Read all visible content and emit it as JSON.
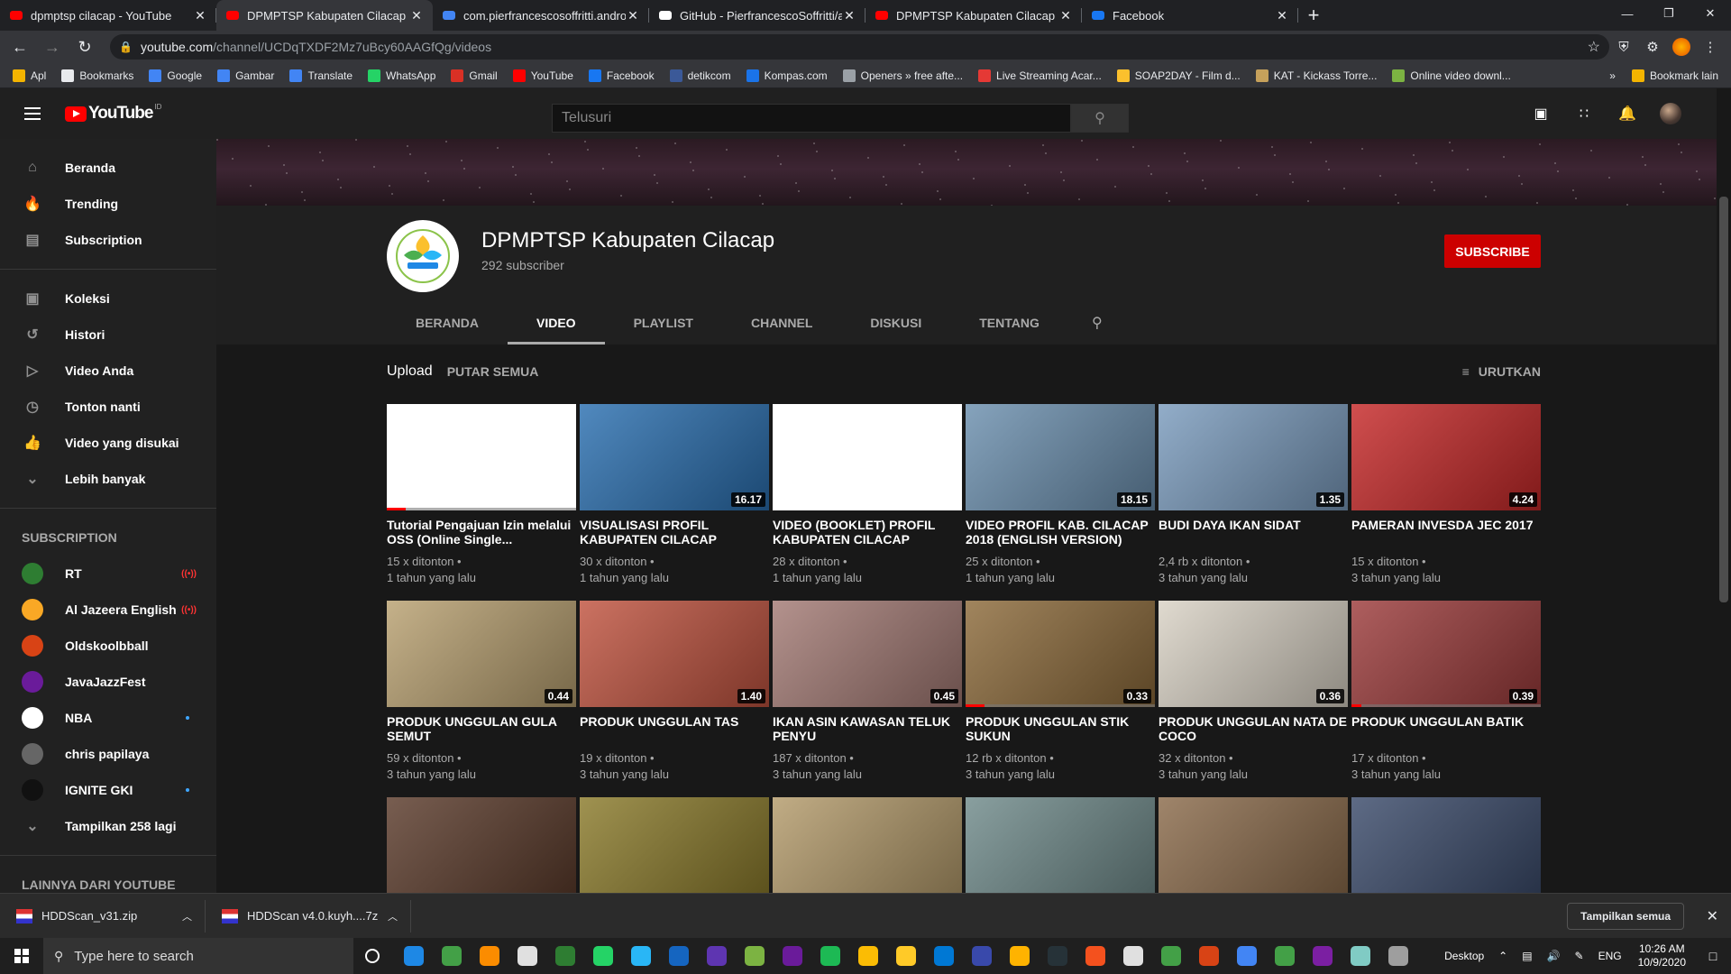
{
  "browser": {
    "tabs": [
      {
        "title": "dpmptsp cilacap - YouTube",
        "icon": "youtube-icon",
        "active": false
      },
      {
        "title": "DPMPTSP Kabupaten Cilacap - YouTube",
        "icon": "youtube-icon",
        "active": true
      },
      {
        "title": "com.pierfrancescosoffritti.android",
        "icon": "google-icon",
        "active": false
      },
      {
        "title": "GitHub - PierfrancescoSoffritti/and",
        "icon": "github-icon",
        "active": false
      },
      {
        "title": "DPMPTSP Kabupaten Cilacap - YouTube",
        "icon": "youtube-icon",
        "active": false
      },
      {
        "title": "Facebook",
        "icon": "facebook-icon",
        "active": false
      }
    ],
    "url_host": "youtube.com",
    "url_path": "/channel/UCDqTXDF2Mz7uBcy60AAGfQg/videos",
    "bookmarks": [
      {
        "label": "Apl",
        "color": "#f4b400"
      },
      {
        "label": "Bookmarks",
        "color": "#e8eaed"
      },
      {
        "label": "Google",
        "color": "#4285f4"
      },
      {
        "label": "Gambar",
        "color": "#4285f4"
      },
      {
        "label": "Translate",
        "color": "#4285f4"
      },
      {
        "label": "WhatsApp",
        "color": "#25d366"
      },
      {
        "label": "Gmail",
        "color": "#d93025"
      },
      {
        "label": "YouTube",
        "color": "#ff0000"
      },
      {
        "label": "Facebook",
        "color": "#1877f2"
      },
      {
        "label": "detikcom",
        "color": "#3b5998"
      },
      {
        "label": "Kompas.com",
        "color": "#1a73e8"
      },
      {
        "label": "Openers » free afte...",
        "color": "#9aa0a6"
      },
      {
        "label": "Live Streaming Acar...",
        "color": "#e53935"
      },
      {
        "label": "SOAP2DAY - Film d...",
        "color": "#fbc02d"
      },
      {
        "label": "KAT - Kickass Torre...",
        "color": "#c6a15b"
      },
      {
        "label": "Online video downl...",
        "color": "#7cb342"
      }
    ],
    "bookmark_more": "»",
    "other_bookmarks": "Bookmark lain"
  },
  "youtube": {
    "logo_text": "YouTube",
    "region": "ID",
    "search_placeholder": "Telusuri"
  },
  "sidebar": {
    "primary": [
      {
        "label": "Beranda",
        "icon": "home-icon",
        "glyph": "⌂"
      },
      {
        "label": "Trending",
        "icon": "flame-icon",
        "glyph": "🔥"
      },
      {
        "label": "Subscription",
        "icon": "subscriptions-icon",
        "glyph": "▤"
      }
    ],
    "library": [
      {
        "label": "Koleksi",
        "icon": "library-icon",
        "glyph": "▣"
      },
      {
        "label": "Histori",
        "icon": "history-icon",
        "glyph": "↺"
      },
      {
        "label": "Video Anda",
        "icon": "your-videos-icon",
        "glyph": "▷"
      },
      {
        "label": "Tonton nanti",
        "icon": "watch-later-icon",
        "glyph": "◷"
      },
      {
        "label": "Video yang disukai",
        "icon": "thumbs-up-icon",
        "glyph": "👍"
      },
      {
        "label": "Lebih banyak",
        "icon": "chevron-down-icon",
        "glyph": "⌄"
      }
    ],
    "subscription_heading": "SUBSCRIPTION",
    "subscriptions": [
      {
        "label": "RT",
        "color": "#2e7d32",
        "badge": "live"
      },
      {
        "label": "Al Jazeera English",
        "color": "#f9a825",
        "badge": "live"
      },
      {
        "label": "Oldskoolbball",
        "color": "#d84315",
        "badge": ""
      },
      {
        "label": "JavaJazzFest",
        "color": "#6a1b9a",
        "badge": ""
      },
      {
        "label": "NBA",
        "color": "#ffffff",
        "badge": "dot"
      },
      {
        "label": "chris papilaya",
        "color": "#666666",
        "badge": ""
      },
      {
        "label": "IGNITE GKI",
        "color": "#111111",
        "badge": "dot"
      }
    ],
    "show_more": "Tampilkan 258 lagi",
    "more_heading": "LAINNYA DARI YOUTUBE"
  },
  "channel": {
    "name": "DPMPTSP Kabupaten Cilacap",
    "subscribers": "292 subscriber",
    "subscribe_label": "SUBSCRIBE",
    "tabs": [
      "BERANDA",
      "VIDEO",
      "PLAYLIST",
      "CHANNEL",
      "DISKUSI",
      "TENTANG"
    ],
    "active_tab": "VIDEO",
    "section_title": "Upload",
    "play_all": "PUTAR SEMUA",
    "sort_label": "URUTKAN"
  },
  "videos": [
    {
      "title": "Tutorial Pengajuan Izin melalui OSS (Online Single...",
      "views": "15 x ditonton •",
      "age": "1 tahun yang lalu",
      "duration": "",
      "thumb": "#ffffff",
      "progress": 0.1,
      "normal_case": true
    },
    {
      "title": "VISUALISASI PROFIL KABUPATEN CILACAP",
      "views": "30 x ditonton •",
      "age": "1 tahun yang lalu",
      "duration": "16.17",
      "thumb": "#2a6fb0",
      "progress": 0
    },
    {
      "title": "VIDEO (BOOKLET) PROFIL KABUPATEN CILACAP",
      "views": "28 x ditonton •",
      "age": "1 tahun yang lalu",
      "duration": "",
      "thumb": "#ffffff",
      "progress": 0
    },
    {
      "title": "VIDEO PROFIL KAB. CILACAP 2018 (English Version)",
      "views": "25 x ditonton •",
      "age": "1 tahun yang lalu",
      "duration": "18.15",
      "thumb": "#6b8fae",
      "progress": 0
    },
    {
      "title": "BUDI DAYA IKAN SIDAT",
      "views": "2,4 rb x ditonton •",
      "age": "3 tahun yang lalu",
      "duration": "1.35",
      "thumb": "#7a9bbd",
      "progress": 0
    },
    {
      "title": "PAMERAN INVESDA JEC 2017",
      "views": "15 x ditonton •",
      "age": "3 tahun yang lalu",
      "duration": "4.24",
      "thumb": "#c62828",
      "progress": 0
    },
    {
      "title": "PRODUK UNGGULAN GULA SEMUT",
      "views": "59 x ditonton •",
      "age": "3 tahun yang lalu",
      "duration": "0.44",
      "thumb": "#b8a070",
      "progress": 0
    },
    {
      "title": "PRODUK UNGGULAN TAS",
      "views": "19 x ditonton •",
      "age": "3 tahun yang lalu",
      "duration": "1.40",
      "thumb": "#c0533f",
      "progress": 0
    },
    {
      "title": "IKAN ASIN KAWASAN TELUK PENYU",
      "views": "187 x ditonton •",
      "age": "3 tahun yang lalu",
      "duration": "0.45",
      "thumb": "#a37a74",
      "progress": 0
    },
    {
      "title": "PRODUK UNGGULAN STIK SUKUN",
      "views": "12 rb x ditonton •",
      "age": "3 tahun yang lalu",
      "duration": "0.33",
      "thumb": "#8c6a3a",
      "progress": 0.1
    },
    {
      "title": "PRODUK UNGGULAN NATA DE COCO",
      "views": "32 x ditonton •",
      "age": "3 tahun yang lalu",
      "duration": "0.36",
      "thumb": "#d9d2c5",
      "progress": 0
    },
    {
      "title": "PRODUK UNGGULAN BATIK",
      "views": "17 x ditonton •",
      "age": "3 tahun yang lalu",
      "duration": "0.39",
      "thumb": "#9c3b3b",
      "progress": 0.05
    },
    {
      "title": "",
      "views": "",
      "age": "",
      "duration": "",
      "thumb": "#5a3a2a",
      "progress": 0
    },
    {
      "title": "",
      "views": "",
      "age": "",
      "duration": "",
      "thumb": "#8a7a2a",
      "progress": 0
    },
    {
      "title": "",
      "views": "",
      "age": "",
      "duration": "",
      "thumb": "#b39a6a",
      "progress": 0
    },
    {
      "title": "",
      "views": "",
      "age": "",
      "duration": "",
      "thumb": "#6f8a8a",
      "progress": 0
    },
    {
      "title": "",
      "views": "",
      "age": "",
      "duration": "",
      "thumb": "#8a6a4a",
      "progress": 0
    },
    {
      "title": "",
      "views": "",
      "age": "",
      "duration": "",
      "thumb": "#3a4a6a",
      "progress": 0
    }
  ],
  "downloads": [
    {
      "name": "HDDScan_v31.zip"
    },
    {
      "name": "HDDScan v4.0.kuyh....7z"
    }
  ],
  "download_show_all": "Tampilkan semua",
  "taskbar": {
    "search_placeholder": "Type here to search",
    "desktop": "Desktop",
    "lang": "ENG",
    "time": "10:26 AM",
    "date": "10/9/2020",
    "apps": [
      "#1e88e5",
      "#43a047",
      "#fb8c00",
      "#e0e0e0",
      "#2e7d32",
      "#25d366",
      "#29b6f6",
      "#1565c0",
      "#5e35b1",
      "#7cb342",
      "#6a1b9a",
      "#1db954",
      "#fbbc04",
      "#ffca28",
      "#0078d4",
      "#3949ab",
      "#ffb300",
      "#263238",
      "#f4511e",
      "#e0e0e0",
      "#43a047",
      "#d84315",
      "#4285f4",
      "#43a047",
      "#7b1fa2",
      "#80cbc4",
      "#9e9e9e"
    ]
  }
}
